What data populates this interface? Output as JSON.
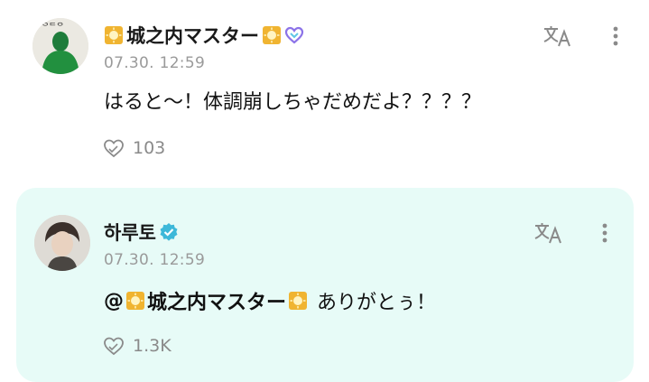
{
  "comments": [
    {
      "author": "城之内マスター",
      "timestamp": "07.30. 12:59",
      "text": "はると〜！体調崩しちゃだめだよ？？？？",
      "likes": "103"
    },
    {
      "author": "하루토",
      "timestamp": "07.30. 12:59",
      "mention": "@",
      "mention_name": "城之内マスター",
      "text": "ありがとぅ！",
      "likes": "1.3K"
    }
  ],
  "icons": {
    "translate": "translate-icon",
    "more": "more-vertical-icon",
    "like": "heart-hand-icon",
    "badge": "sun-badge-icon",
    "membership": "heart-badge-icon",
    "verified": "verified-badge-icon"
  },
  "colors": {
    "highlight_bg": "#e7fbf7",
    "verified": "#3db8d9",
    "membership_heart": "#8c73e8",
    "timestamp": "#9a9a9a"
  }
}
